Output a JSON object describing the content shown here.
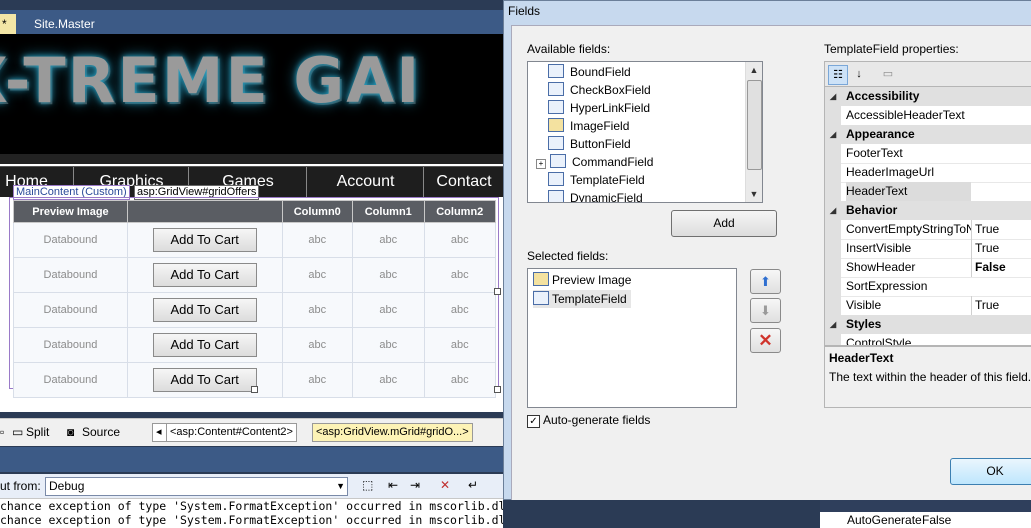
{
  "ide": {
    "tabs": [
      "*",
      "Site.Master"
    ],
    "banner_text": "X-TREME GAI",
    "nav": [
      "Home",
      "Graphics",
      "Games",
      "Account",
      "Contact"
    ],
    "content_tag": "MainContent (Custom)",
    "grid_tag": "asp:GridView#gridOffers",
    "grid": {
      "headers": [
        "Preview Image",
        "",
        "Column0",
        "Column1",
        "Column2"
      ],
      "rows": [
        [
          "Databound",
          "Add To Cart",
          "abc",
          "abc",
          "abc"
        ],
        [
          "Databound",
          "Add To Cart",
          "abc",
          "abc",
          "abc"
        ],
        [
          "Databound",
          "Add To Cart",
          "abc",
          "abc",
          "abc"
        ],
        [
          "Databound",
          "Add To Cart",
          "abc",
          "abc",
          "abc"
        ],
        [
          "Databound",
          "Add To Cart",
          "abc",
          "abc",
          "abc"
        ]
      ]
    },
    "bottom": {
      "split": "Split",
      "source": "Source",
      "crumb1": "<asp:Content#Content2>",
      "crumb2": "<asp:GridView.mGrid#gridO...>"
    },
    "output": {
      "show_from_label": "ut from:",
      "show_from_value": "Debug",
      "lines": [
        "chance exception of type 'System.FormatException' occurred in mscorlib.dll",
        "chance exception of type 'System.FormatException' occurred in mscorlib.dll"
      ]
    },
    "right_row": {
      "name": "AutoGenerate",
      "value": "False"
    }
  },
  "dialog": {
    "title": "Fields",
    "available_label": "Available fields:",
    "available_fields": [
      "BoundField",
      "CheckBoxField",
      "HyperLinkField",
      "ImageField",
      "ButtonField",
      "CommandField",
      "TemplateField",
      "DynamicField"
    ],
    "add_button": "Add",
    "selected_label": "Selected fields:",
    "selected_fields": [
      "Preview Image",
      "TemplateField"
    ],
    "auto_generate_label": "Auto-generate fields",
    "auto_generate_checked": true,
    "properties_label": "TemplateField properties:",
    "properties": [
      {
        "type": "cat",
        "name": "Accessibility"
      },
      {
        "type": "item",
        "name": "AccessibleHeaderText",
        "value": ""
      },
      {
        "type": "cat",
        "name": "Appearance"
      },
      {
        "type": "item",
        "name": "FooterText",
        "value": ""
      },
      {
        "type": "item",
        "name": "HeaderImageUrl",
        "value": ""
      },
      {
        "type": "item",
        "name": "HeaderText",
        "value": "",
        "selected": true
      },
      {
        "type": "cat",
        "name": "Behavior"
      },
      {
        "type": "item",
        "name": "ConvertEmptyStringToNull",
        "value": "True"
      },
      {
        "type": "item",
        "name": "InsertVisible",
        "value": "True"
      },
      {
        "type": "item",
        "name": "ShowHeader",
        "value": "False",
        "bold": true
      },
      {
        "type": "item",
        "name": "SortExpression",
        "value": ""
      },
      {
        "type": "item",
        "name": "Visible",
        "value": "True"
      },
      {
        "type": "cat",
        "name": "Styles"
      },
      {
        "type": "item",
        "name": "ControlStyle",
        "value": ""
      }
    ],
    "description_title": "HeaderText",
    "description_text": "The text within the header of this field.",
    "ok_button": "OK"
  },
  "colors": {
    "ide_blue": "#3c5a86",
    "dialog_frame": "#c7d9ee",
    "delete_red": "#d0342c",
    "arrow_blue": "#2f6fd0"
  }
}
